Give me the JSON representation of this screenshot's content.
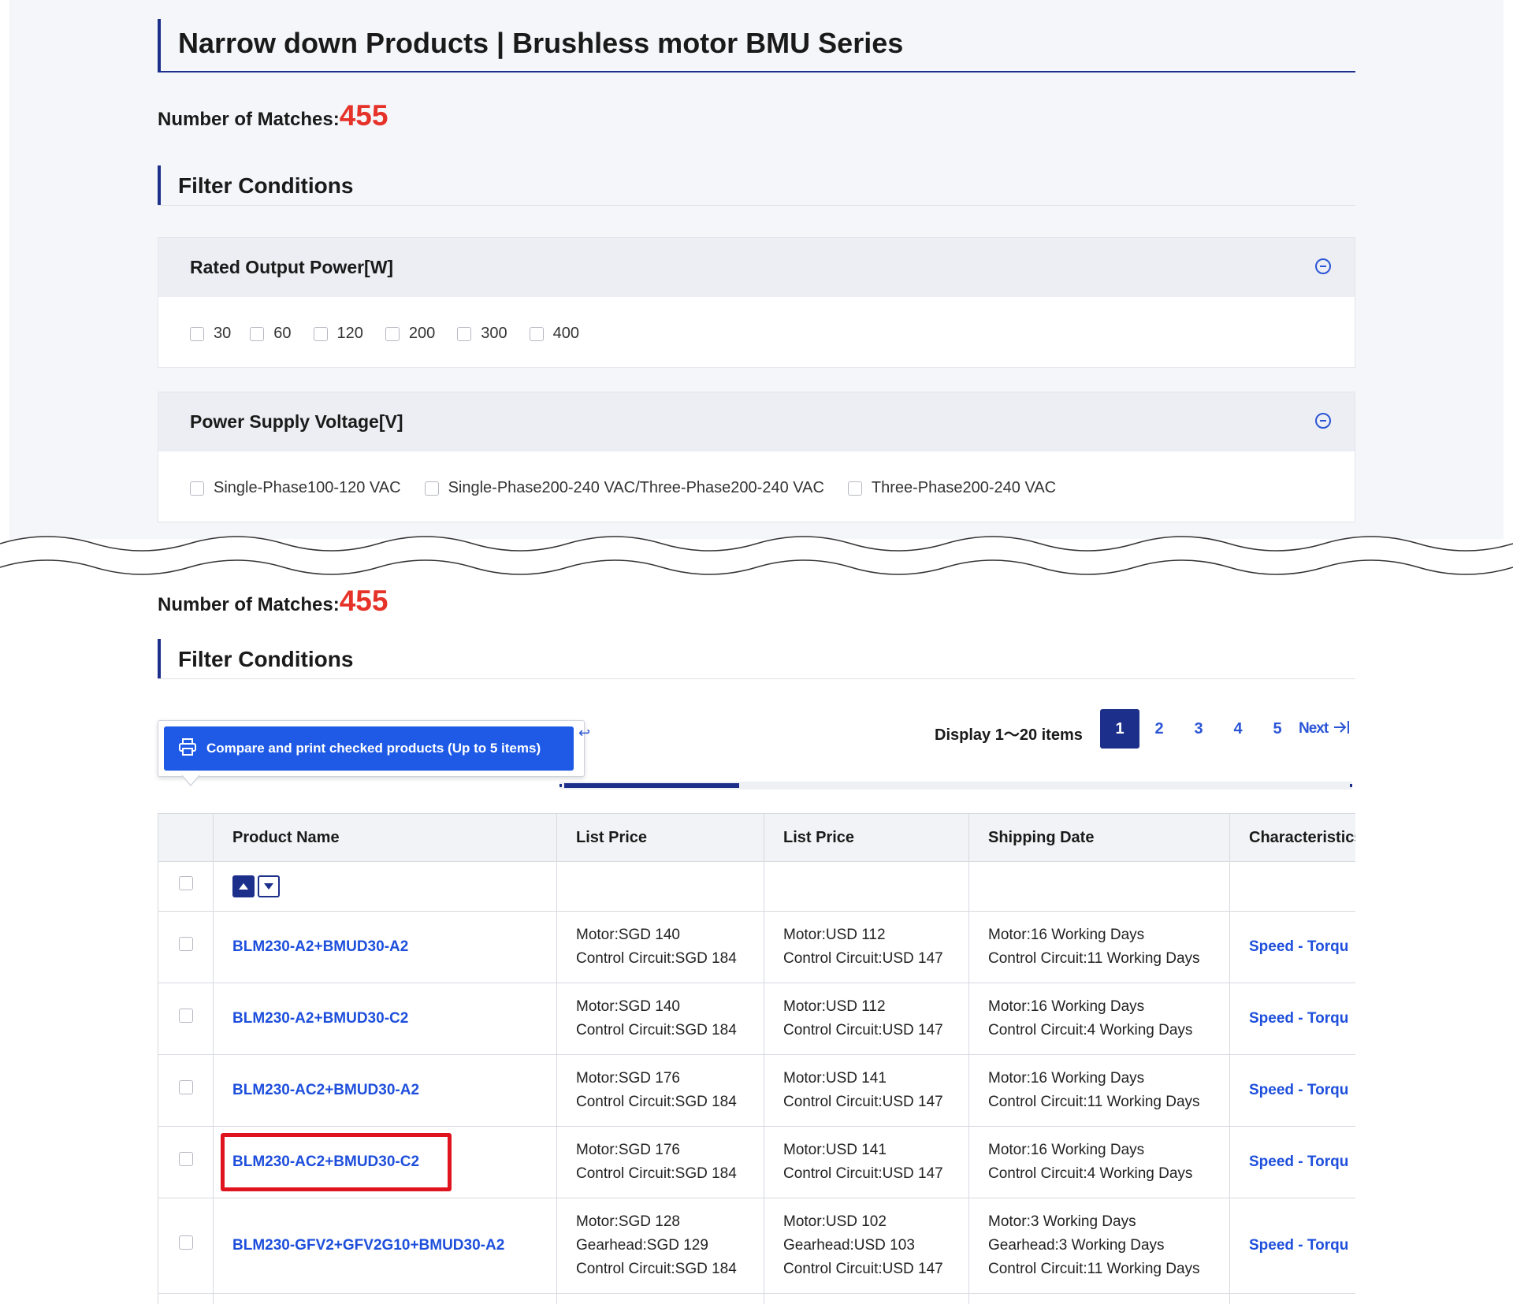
{
  "page": {
    "title": "Narrow down Products | Brushless motor BMU Series"
  },
  "matches": {
    "label": "Number of Matches:",
    "count": "455"
  },
  "filter": {
    "heading": "Filter Conditions",
    "groups": [
      {
        "label": "Rated Output Power[W]",
        "options": [
          "30",
          "60",
          "120",
          "200",
          "300",
          "400"
        ]
      },
      {
        "label": "Power Supply Voltage[V]",
        "options": [
          "Single-Phase100-120 VAC",
          "Single-Phase200-240 VAC/Three-Phase200-240 VAC",
          "Three-Phase200-240 VAC"
        ]
      }
    ]
  },
  "toolbar": {
    "compare_label": "Compare and print checked products (Up to 5 items)",
    "display_items": "Display 1～20 items",
    "pages": [
      "1",
      "2",
      "3",
      "4",
      "5"
    ],
    "active_page": "1",
    "next_label": "Next"
  },
  "table": {
    "headers": [
      "Product Name",
      "List Price",
      "List Price",
      "Shipping Date",
      "Characteristics"
    ],
    "rows": [
      {
        "name": "BLM230-A2+BMUD30-A2",
        "price1": [
          "Motor:SGD 140",
          "Control Circuit:SGD 184"
        ],
        "price2": [
          "Motor:USD 112",
          "Control Circuit:USD 147"
        ],
        "ship": [
          "Motor:16 Working Days",
          "Control Circuit:11 Working Days"
        ],
        "char": "Speed - Torqu"
      },
      {
        "name": "BLM230-A2+BMUD30-C2",
        "price1": [
          "Motor:SGD 140",
          "Control Circuit:SGD 184"
        ],
        "price2": [
          "Motor:USD 112",
          "Control Circuit:USD 147"
        ],
        "ship": [
          "Motor:16 Working Days",
          "Control Circuit:4 Working Days"
        ],
        "char": "Speed - Torqu"
      },
      {
        "name": "BLM230-AC2+BMUD30-A2",
        "price1": [
          "Motor:SGD 176",
          "Control Circuit:SGD 184"
        ],
        "price2": [
          "Motor:USD 141",
          "Control Circuit:USD 147"
        ],
        "ship": [
          "Motor:16 Working Days",
          "Control Circuit:11 Working Days"
        ],
        "char": "Speed - Torqu"
      },
      {
        "name": "BLM230-AC2+BMUD30-C2",
        "price1": [
          "Motor:SGD 176",
          "Control Circuit:SGD 184"
        ],
        "price2": [
          "Motor:USD 141",
          "Control Circuit:USD 147"
        ],
        "ship": [
          "Motor:16 Working Days",
          "Control Circuit:4 Working Days"
        ],
        "char": "Speed - Torqu"
      },
      {
        "name": "BLM230-GFV2+GFV2G10+BMUD30-A2",
        "price1": [
          "Motor:SGD 128",
          "Gearhead:SGD 129",
          "Control Circuit:SGD 184"
        ],
        "price2": [
          "Motor:USD 102",
          "Gearhead:USD 103",
          "Control Circuit:USD 147"
        ],
        "ship": [
          "Motor:3 Working Days",
          "Gearhead:3 Working Days",
          "Control Circuit:11 Working Days"
        ],
        "char": "Speed - Torqu"
      }
    ]
  },
  "colors": {
    "navy": "#1c2f8a",
    "link_blue": "#1e4fdc",
    "button_blue": "#1e5ae6",
    "count_red": "#e63329",
    "highlight_red": "#e0141e"
  },
  "icons": [
    "collapse-icon",
    "printer-icon",
    "sort-ascending-icon",
    "sort-descending-icon",
    "last-page-icon"
  ]
}
